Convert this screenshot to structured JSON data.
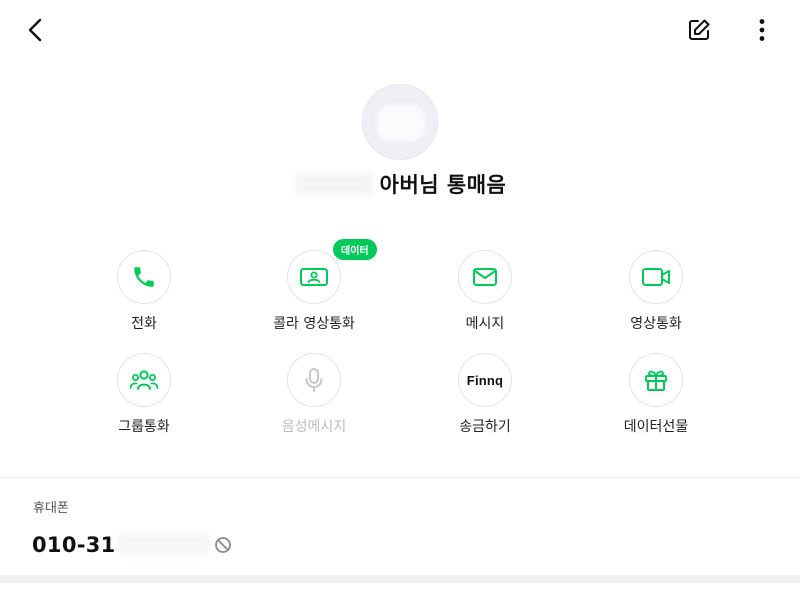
{
  "header": {
    "back": "back",
    "edit": "edit",
    "more": "more"
  },
  "profile": {
    "name": "아버님 통매음"
  },
  "actions": [
    {
      "label": "전화",
      "icon": "phone-icon"
    },
    {
      "label": "콜라 영상통화",
      "icon": "video-call-icon",
      "badge": "데이터"
    },
    {
      "label": "메시지",
      "icon": "mail-icon"
    },
    {
      "label": "영상통화",
      "icon": "video-camera-icon"
    },
    {
      "label": "그룹통화",
      "icon": "group-icon"
    },
    {
      "label": "음성메시지",
      "icon": "microphone-icon",
      "disabled": true
    },
    {
      "label": "송금하기",
      "icon": "finnq-logo",
      "logo_text": "Finnq"
    },
    {
      "label": "데이터선물",
      "icon": "gift-icon"
    }
  ],
  "contact": {
    "section_label": "휴대폰",
    "number": "010-31"
  },
  "colors": {
    "accent": "#00c95b",
    "disabled": "#c8c8c8",
    "text": "#111111"
  }
}
